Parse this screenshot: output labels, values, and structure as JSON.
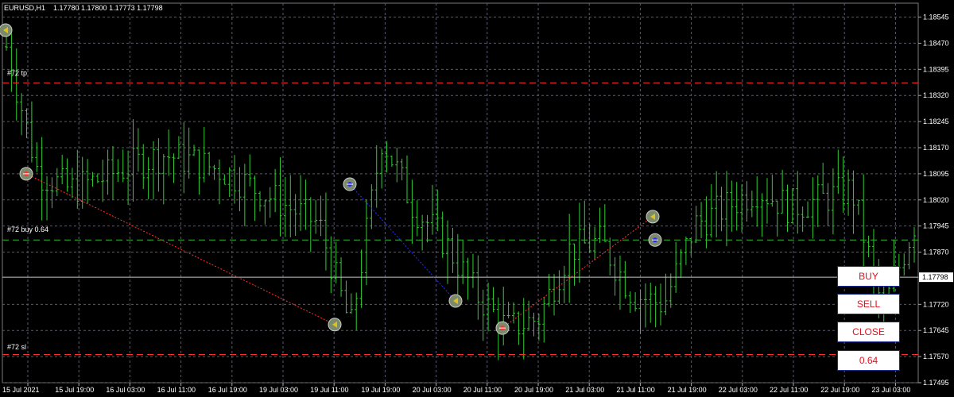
{
  "header": {
    "symbol_timeframe": "EURUSD,H1",
    "ohlc": "1.17780 1.17800 1.17773 1.17798"
  },
  "price_axis": {
    "labels": [
      "1.18545",
      "1.18470",
      "1.18395",
      "1.18320",
      "1.18245",
      "1.18170",
      "1.18095",
      "1.18020",
      "1.17945",
      "1.17870",
      "1.17720",
      "1.17645",
      "1.17570",
      "1.17495"
    ],
    "current_price": "1.17798"
  },
  "time_axis": {
    "labels": [
      "15 Jul 2021",
      "15 Jul 19:00",
      "16 Jul 03:00",
      "16 Jul 11:00",
      "16 Jul 19:00",
      "19 Jul 03:00",
      "19 Jul 11:00",
      "19 Jul 19:00",
      "20 Jul 03:00",
      "20 Jul 11:00",
      "20 Jul 19:00",
      "21 Jul 03:00",
      "21 Jul 11:00",
      "21 Jul 19:00",
      "22 Jul 03:00",
      "22 Jul 11:00",
      "22 Jul 19:00",
      "23 Jul 03:00"
    ]
  },
  "levels": {
    "tp_label": "#72 tp",
    "buy_label": "#72 buy 0.64",
    "sl_label": "#72 sl",
    "tp_price": 1.18356,
    "buy_price": 1.17905,
    "sl_price": 1.17576,
    "current_price": 1.17798
  },
  "buttons": {
    "buy": "BUY",
    "sell": "SELL",
    "close": "CLOSE",
    "lot": "0.64"
  },
  "colors": {
    "background": "#000000",
    "grid": "#5a5a6e",
    "candle": "#32cd32",
    "tp_line": "#ff3030",
    "sl_line": "#ff3030",
    "buy_line": "#2eb82e",
    "current_line": "#c8c8c8",
    "button_text": "#e0101e",
    "button_border": "#1a2a8c"
  },
  "chart_data": {
    "type": "ohlc",
    "symbol": "EURUSD",
    "timeframe": "H1",
    "ylim": [
      1.17495,
      1.18585
    ],
    "x": [
      "15 Jul 2021",
      "15 Jul 19:00",
      "16 Jul 03:00",
      "16 Jul 11:00",
      "16 Jul 19:00",
      "19 Jul 03:00",
      "19 Jul 11:00",
      "19 Jul 19:00",
      "20 Jul 03:00",
      "20 Jul 11:00",
      "20 Jul 19:00",
      "21 Jul 03:00",
      "21 Jul 11:00",
      "21 Jul 19:00",
      "22 Jul 03:00",
      "22 Jul 11:00",
      "22 Jul 19:00",
      "23 Jul 03:00"
    ],
    "close_path": [
      1.1846,
      1.181,
      1.1805,
      1.1808,
      1.1812,
      1.1815,
      1.1813,
      1.181,
      1.1805,
      1.18,
      1.1795,
      1.1765,
      1.182,
      1.18,
      1.179,
      1.1775,
      1.1765,
      1.1768,
      1.1788,
      1.179,
      1.1775,
      1.1772,
      1.1795,
      1.18,
      1.1805,
      1.18,
      1.1802,
      1.1805,
      1.177,
      1.1795
    ],
    "trades": [
      {
        "entry": 1.18095,
        "exit": 1.17662
      },
      {
        "entry": 1.18065,
        "exit": 1.1773
      },
      {
        "entry": 1.17652,
        "exit": 1.17972
      },
      {
        "entry": 1.17905,
        "exit": null
      }
    ],
    "grid": true
  }
}
